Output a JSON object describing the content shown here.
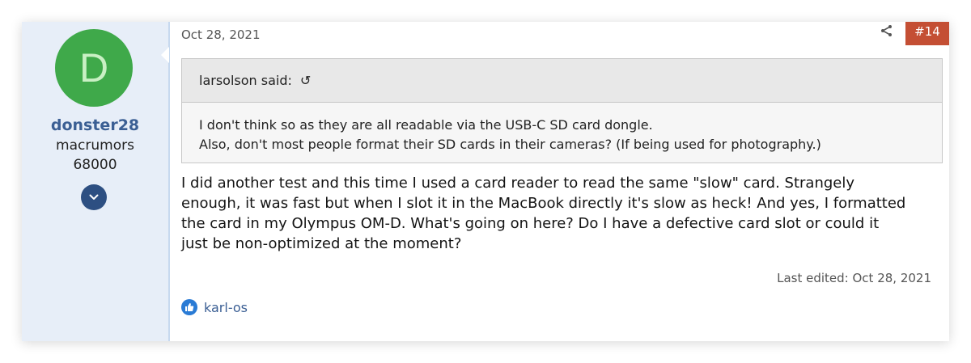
{
  "user": {
    "avatar_letter": "D",
    "name": "donster28",
    "title_line1": "macrumors",
    "title_line2": "68000",
    "avatar_color": "#3fa94a",
    "expand_icon": "chevron-down-icon"
  },
  "post": {
    "date": "Oct 28, 2021",
    "number": "#14",
    "share_icon": "share-icon",
    "quote": {
      "author_line": "larsolson said:",
      "jump_icon": "↺",
      "line1": "I don't think so as they are all readable via the USB-C SD card dongle.",
      "line2": "Also, don't most people format their SD cards in their cameras? (If being used for photography.)"
    },
    "message_lines": [
      "I did another test and this time I used a card reader to read the same \"slow\" card. Strangely",
      "enough, it was fast but when I slot it in the MacBook directly it's slow as heck! And yes, I formatted",
      "the card in my Olympus OM-D. What's going on here? Do I have a defective card slot or could it",
      "just be non-optimized at the moment?"
    ],
    "last_edited": "Last edited: Oct 28, 2021",
    "reactions": {
      "icon": "like-icon",
      "users": "karl-os"
    }
  },
  "colors": {
    "accent": "#3b5f94",
    "post_number_bg": "#c44f34",
    "sidebar_bg": "#e7eef8"
  }
}
